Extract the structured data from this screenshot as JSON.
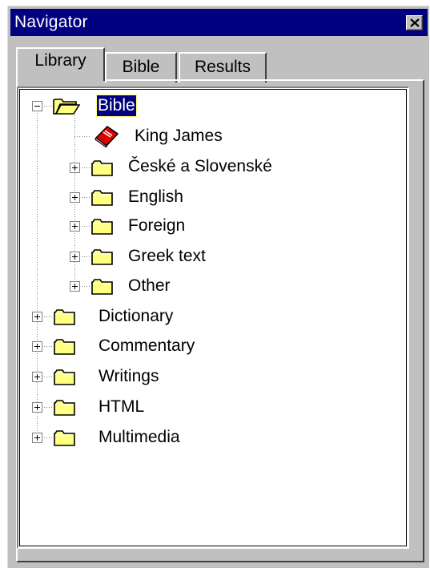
{
  "window": {
    "title": "Navigator",
    "close_icon": "close-icon"
  },
  "tabs": [
    {
      "label": "Library",
      "active": true
    },
    {
      "label": "Bible",
      "active": false
    },
    {
      "label": "Results",
      "active": false
    }
  ],
  "tree": {
    "root": {
      "label": "Bible",
      "expanded": true,
      "selected": true,
      "icon": "folder-open-icon",
      "children": [
        {
          "label": "King James",
          "icon": "book-icon"
        },
        {
          "label": "České a Slovenské",
          "icon": "folder-icon",
          "expandable": true
        },
        {
          "label": "English",
          "icon": "folder-icon",
          "expandable": true
        },
        {
          "label": "Foreign",
          "icon": "folder-icon",
          "expandable": true
        },
        {
          "label": "Greek text",
          "icon": "folder-icon",
          "expandable": true
        },
        {
          "label": "Other",
          "icon": "folder-icon",
          "expandable": true
        }
      ]
    },
    "top_level": [
      {
        "label": "Dictionary",
        "icon": "folder-icon",
        "expandable": true
      },
      {
        "label": "Commentary",
        "icon": "folder-icon",
        "expandable": true
      },
      {
        "label": "Writings",
        "icon": "folder-icon",
        "expandable": true
      },
      {
        "label": "HTML",
        "icon": "folder-icon",
        "expandable": true
      },
      {
        "label": "Multimedia",
        "icon": "folder-icon",
        "expandable": true
      }
    ]
  },
  "colors": {
    "title_bar": "#000080",
    "face": "#c0c0c0",
    "folder": "#ffff80",
    "book": "#e00000"
  }
}
